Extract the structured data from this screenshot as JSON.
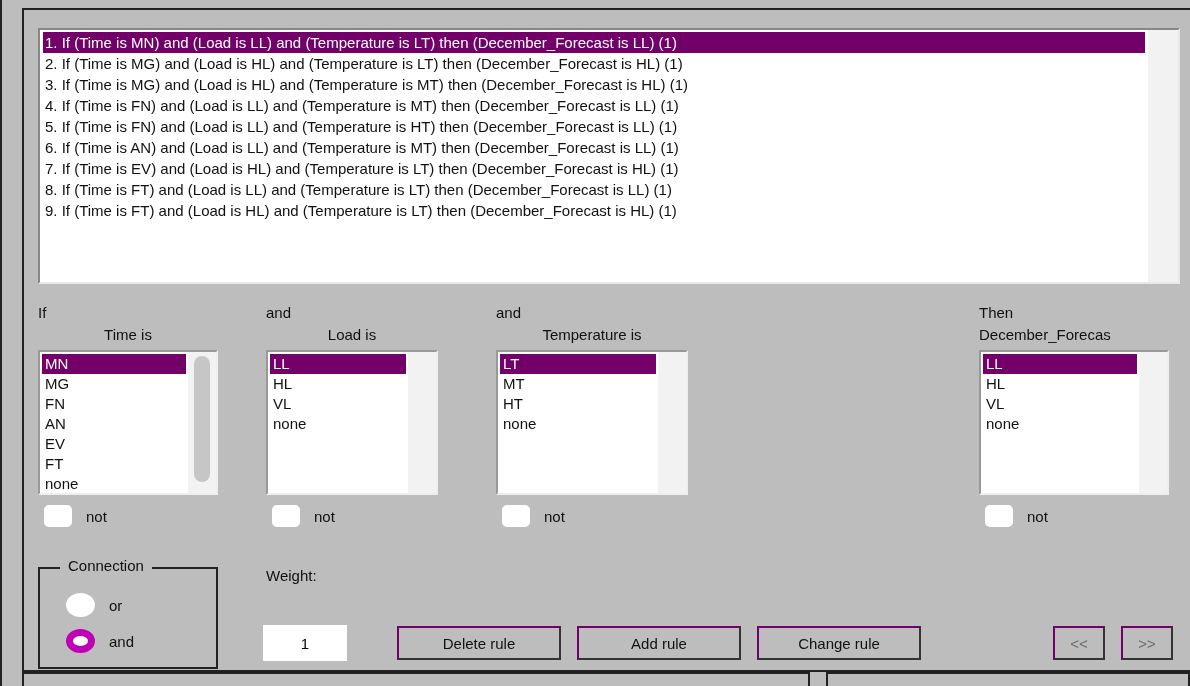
{
  "rules": [
    {
      "text": "1. If (Time is MN) and (Load is LL) and (Temperature is LT) then (December_Forecast is LL) (1)",
      "selected": true
    },
    {
      "text": "2. If (Time is MG) and (Load is HL) and (Temperature is LT) then (December_Forecast is HL) (1)",
      "selected": false
    },
    {
      "text": "3. If (Time is MG) and (Load is HL) and (Temperature is MT) then (December_Forecast is HL) (1)",
      "selected": false
    },
    {
      "text": "4. If (Time is FN) and (Load is LL) and (Temperature is MT) then (December_Forecast is LL) (1)",
      "selected": false
    },
    {
      "text": "5. If (Time is FN) and (Load is LL) and (Temperature is HT) then (December_Forecast is LL) (1)",
      "selected": false
    },
    {
      "text": "6. If (Time is AN) and (Load is LL) and (Temperature is MT) then (December_Forecast is LL) (1)",
      "selected": false
    },
    {
      "text": "7. If (Time is EV) and (Load is HL) and (Temperature is LT) then (December_Forecast is HL) (1)",
      "selected": false
    },
    {
      "text": "8. If (Time is FT) and (Load is LL) and (Temperature is LT) then (December_Forecast is LL) (1)",
      "selected": false
    },
    {
      "text": "9. If (Time is FT) and (Load is HL) and (Temperature is LT) then (December_Forecast is HL) (1)",
      "selected": false
    }
  ],
  "columns": [
    {
      "connector": "If",
      "label": "Time is",
      "not_label": "not",
      "not": false,
      "options": [
        {
          "label": "MN",
          "selected": true
        },
        {
          "label": "MG",
          "selected": false
        },
        {
          "label": "FN",
          "selected": false
        },
        {
          "label": "AN",
          "selected": false
        },
        {
          "label": "EV",
          "selected": false
        },
        {
          "label": "FT",
          "selected": false
        },
        {
          "label": "none",
          "selected": false
        }
      ]
    },
    {
      "connector": "and",
      "label": "Load is",
      "not_label": "not",
      "not": false,
      "options": [
        {
          "label": "LL",
          "selected": true
        },
        {
          "label": "HL",
          "selected": false
        },
        {
          "label": "VL",
          "selected": false
        },
        {
          "label": "none",
          "selected": false
        }
      ]
    },
    {
      "connector": "and",
      "label": "Temperature is",
      "not_label": "not",
      "not": false,
      "options": [
        {
          "label": "LT",
          "selected": true
        },
        {
          "label": "MT",
          "selected": false
        },
        {
          "label": "HT",
          "selected": false
        },
        {
          "label": "none",
          "selected": false
        }
      ]
    },
    {
      "connector": "Then",
      "label": "December_Forecas",
      "not_label": "not",
      "not": false,
      "options": [
        {
          "label": "LL",
          "selected": true
        },
        {
          "label": "HL",
          "selected": false
        },
        {
          "label": "VL",
          "selected": false
        },
        {
          "label": "none",
          "selected": false
        }
      ]
    }
  ],
  "connection": {
    "title": "Connection",
    "options": [
      {
        "label": "or",
        "selected": false
      },
      {
        "label": "and",
        "selected": true
      }
    ]
  },
  "weight": {
    "label": "Weight:",
    "value": "1"
  },
  "actions": [
    {
      "label": "Delete rule",
      "disabled": false
    },
    {
      "label": "Add rule",
      "disabled": false
    },
    {
      "label": "Change rule",
      "disabled": false
    }
  ],
  "navigation": [
    {
      "label": "<<",
      "disabled": true
    },
    {
      "label": ">>",
      "disabled": true
    }
  ]
}
